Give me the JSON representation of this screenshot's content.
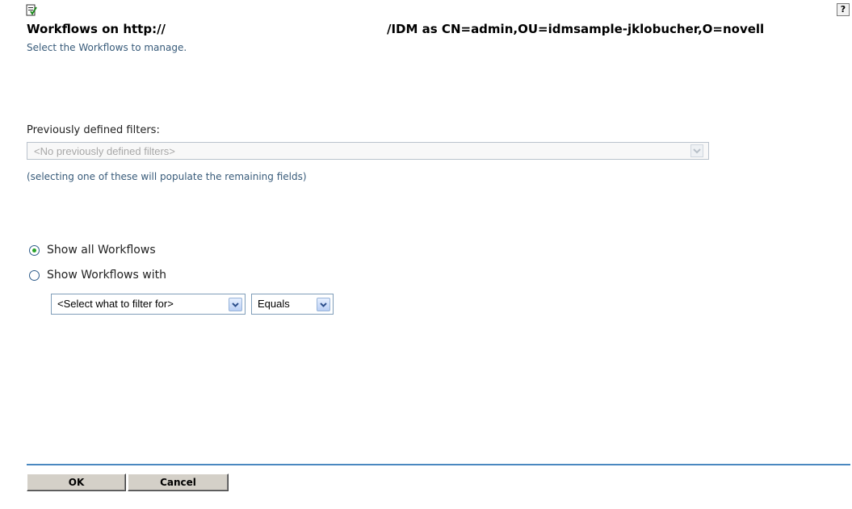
{
  "header": {
    "title_left": "Workflows on http://",
    "title_right": "/IDM as CN=admin,OU=idmsample-jklobucher,O=novell",
    "subtitle": "Select the Workflows to manage.",
    "help_glyph": "?",
    "app_icon": "workflow-page-icon",
    "help_icon": "help-icon"
  },
  "filters": {
    "label": "Previously defined filters:",
    "selected": "<No previously defined filters>",
    "hint": "(selecting one of these will populate the remaining fields)"
  },
  "options": {
    "show_all_label": "Show all Workflows",
    "show_with_label": "Show Workflows with",
    "selected": "show_all"
  },
  "filter_criteria": {
    "field_selected": "<Select what to filter for>",
    "operator_selected": "Equals"
  },
  "footer": {
    "ok_label": "OK",
    "cancel_label": "Cancel"
  },
  "colors": {
    "accent_line": "#4a88c0",
    "hint_text": "#385b7a",
    "radio_selected": "#2aa32a"
  }
}
